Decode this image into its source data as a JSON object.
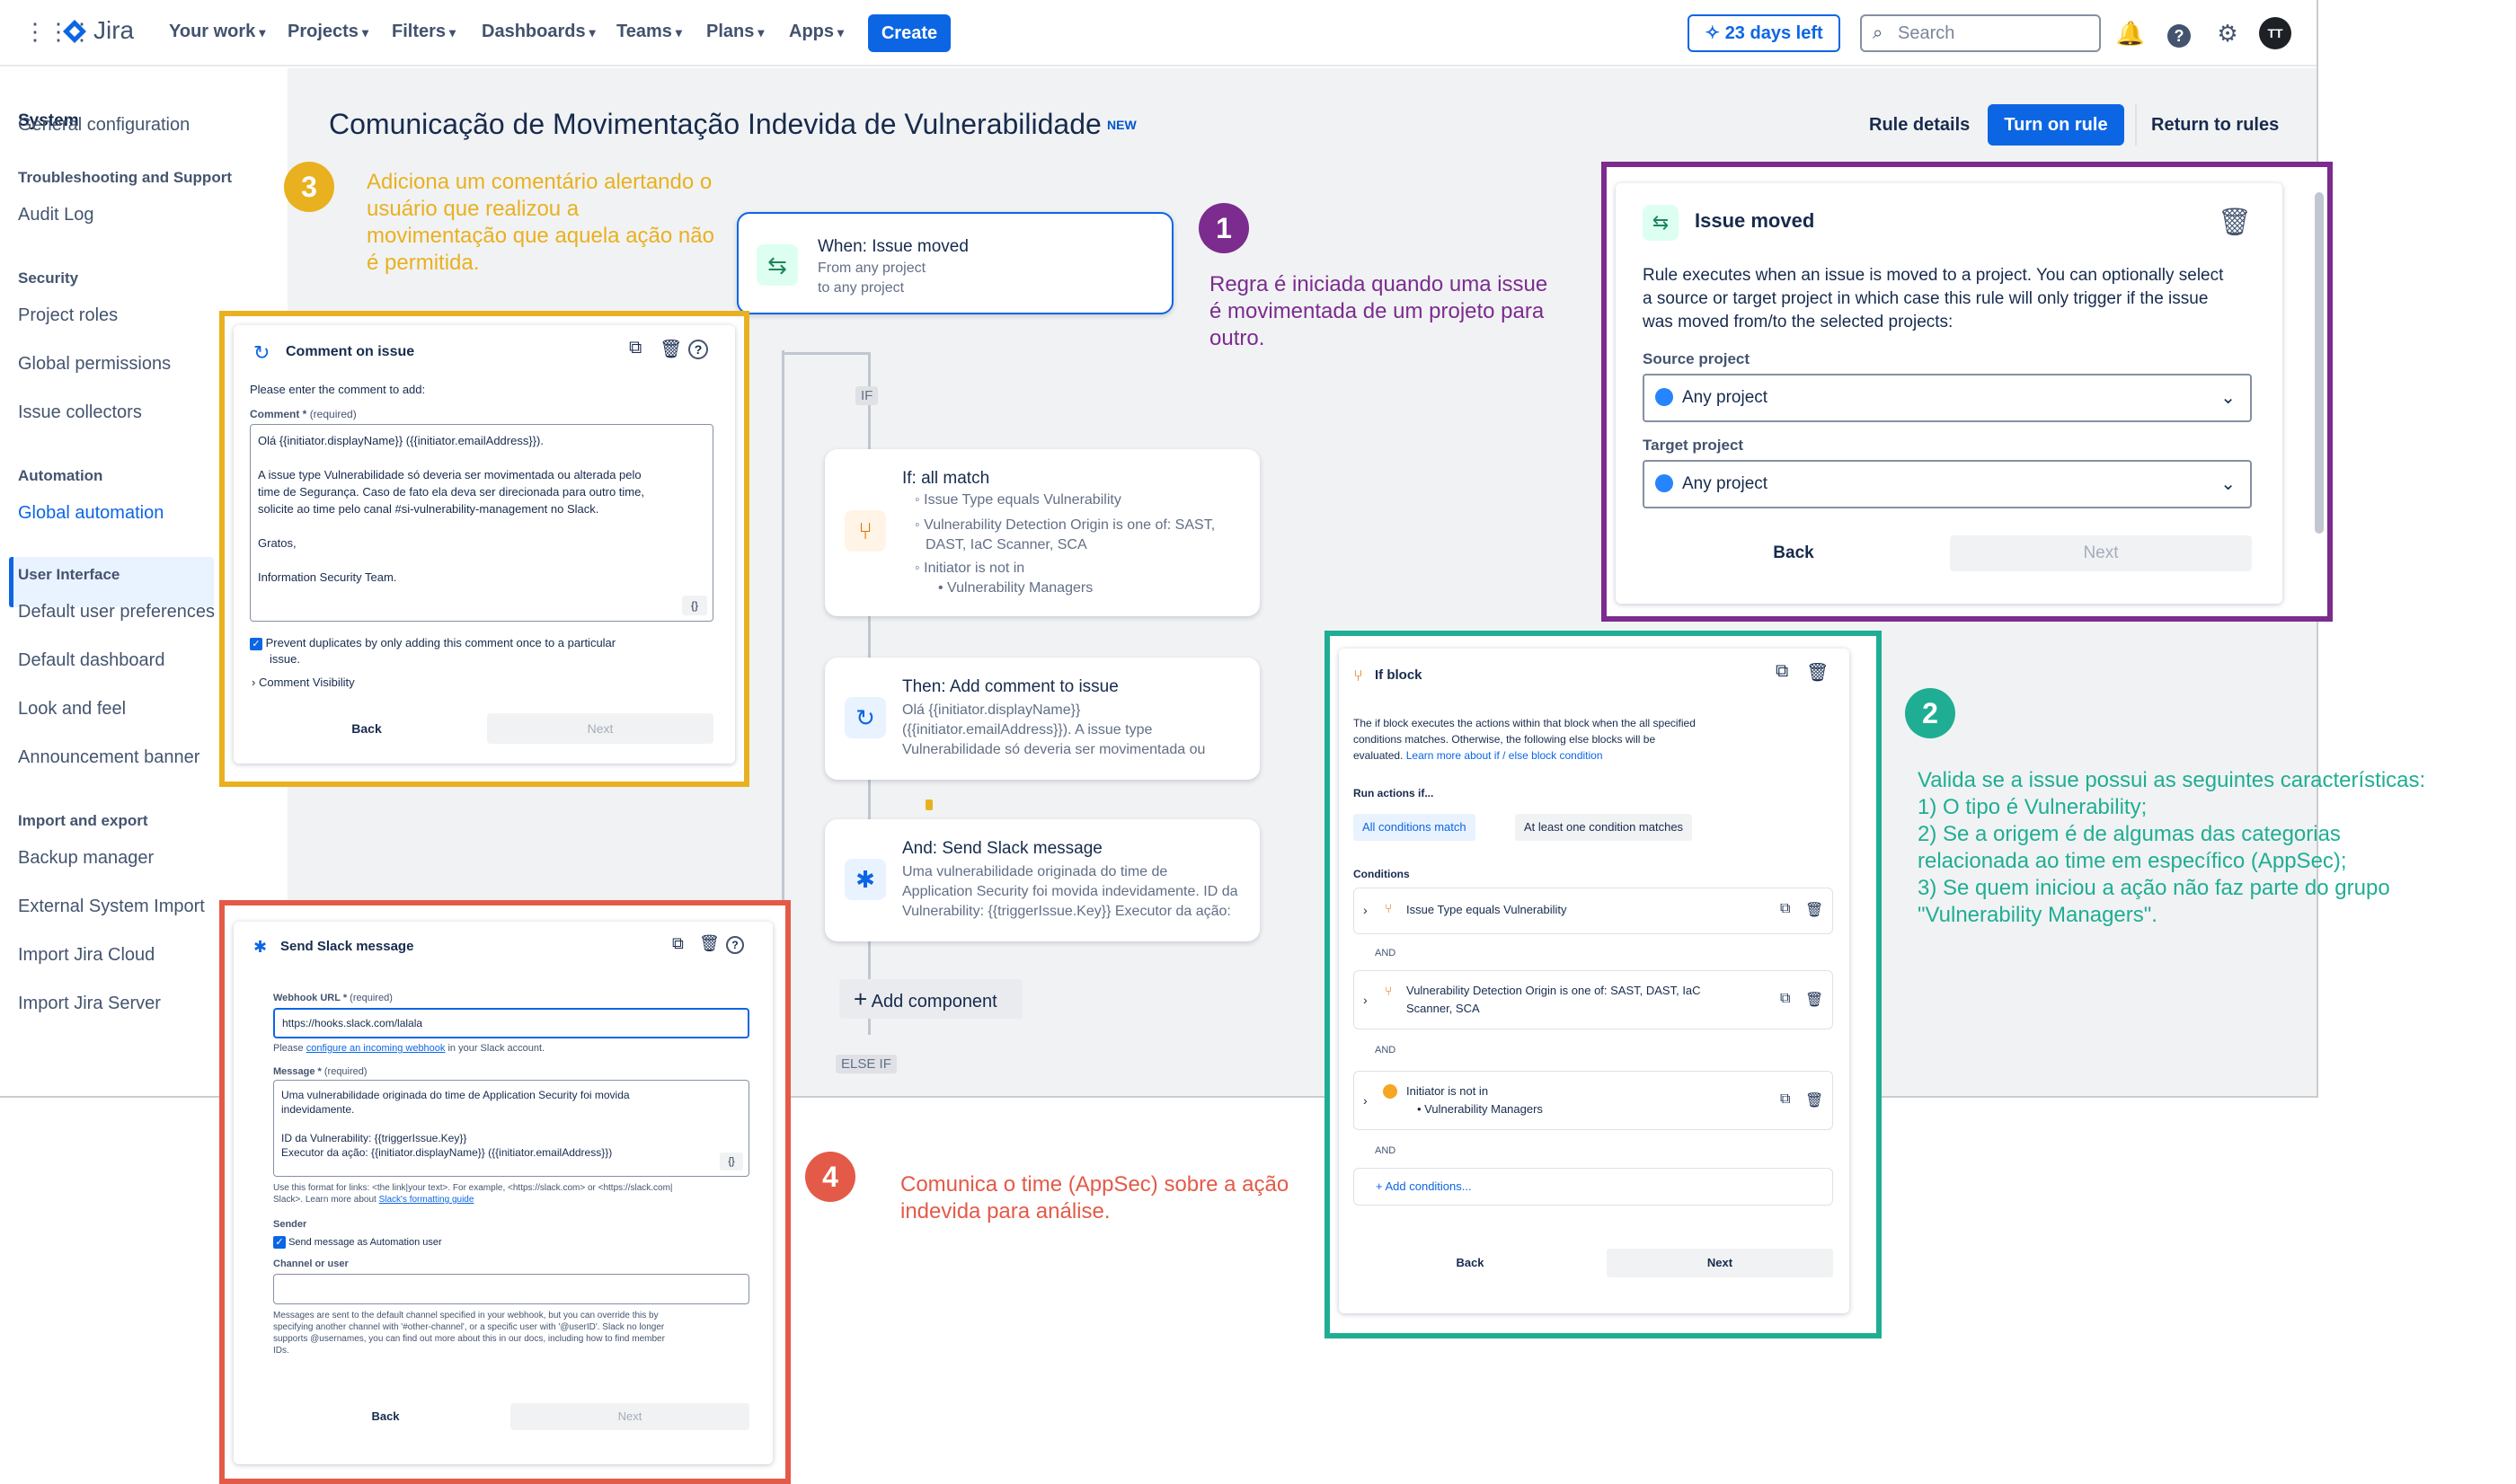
{
  "topnav": {
    "logo": "Jira",
    "items": [
      "Your work",
      "Projects",
      "Filters",
      "Dashboards",
      "Teams",
      "Plans",
      "Apps"
    ],
    "create": "Create",
    "trial": "23 days left",
    "search_placeholder": "Search",
    "avatar": "TT"
  },
  "sidebar": {
    "system": "System",
    "items": [
      {
        "type": "item",
        "label": "General configuration"
      },
      {
        "type": "head",
        "label": "Troubleshooting and Support"
      },
      {
        "type": "item",
        "label": "Audit Log"
      },
      {
        "type": "head",
        "label": "Security"
      },
      {
        "type": "item",
        "label": "Project roles"
      },
      {
        "type": "item",
        "label": "Global permissions"
      },
      {
        "type": "item",
        "label": "Issue collectors"
      },
      {
        "type": "head",
        "label": "Automation"
      },
      {
        "type": "item",
        "label": "Global automation"
      },
      {
        "type": "head",
        "label": "User Interface"
      },
      {
        "type": "item",
        "label": "Default user preferences"
      },
      {
        "type": "item",
        "label": "Default dashboard"
      },
      {
        "type": "item",
        "label": "Look and feel"
      },
      {
        "type": "item",
        "label": "Announcement banner"
      },
      {
        "type": "head",
        "label": "Import and export"
      },
      {
        "type": "item",
        "label": "Backup manager"
      },
      {
        "type": "item",
        "label": "External System Import"
      },
      {
        "type": "item",
        "label": "Import Jira Cloud"
      },
      {
        "type": "item",
        "label": "Import Jira Server"
      }
    ]
  },
  "rule": {
    "title": "Comunicação de Movimentação Indevida de Vulnerabilidade",
    "badge": "NEW",
    "rule_details": "Rule details",
    "turn_on": "Turn on rule",
    "return": "Return to rules"
  },
  "flow": {
    "trigger": {
      "title": "When: Issue moved",
      "sub1": "From any project",
      "sub2": "to any project"
    },
    "if_tag": "IF",
    "ifcard": {
      "title": "If: all match",
      "l1": "Issue Type equals Vulnerability",
      "l2": "Vulnerability Detection Origin is one of: SAST,",
      "l3": "DAST, IaC Scanner, SCA",
      "l4": "Initiator is not in",
      "l5": "Vulnerability Managers"
    },
    "then": {
      "title": "Then: Add comment to issue",
      "l1": "Olá {{initiator.displayName}}",
      "l2": "({{initiator.emailAddress}}). A issue type",
      "l3": "Vulnerabilidade só deveria ser movimentada ou"
    },
    "slack": {
      "title": "And: Send Slack message",
      "l1": "Uma vulnerabilidade originada do time de",
      "l2": "Application Security foi movida indevidamente. ID da",
      "l3": "Vulnerability: {{triggerIssue.Key}} Executor da ação:"
    },
    "add": "Add component",
    "elseif": "ELSE IF"
  },
  "issue_moved": {
    "title": "Issue moved",
    "desc1": "Rule executes when an issue is moved to a project. You can optionally select",
    "desc2": "a source or target project in which case this rule will only trigger if the issue",
    "desc3": "was moved from/to the selected projects:",
    "source_label": "Source project",
    "source_value": "Any project",
    "target_label": "Target project",
    "target_value": "Any project",
    "back": "Back",
    "next": "Next"
  },
  "comment_panel": {
    "title": "Comment on issue",
    "prompt": "Please enter the comment to add:",
    "field_label": "Comment *",
    "required": "(required)",
    "lines": [
      "Olá {{initiator.displayName}} ({{initiator.emailAddress}}).",
      "",
      "A issue type Vulnerabilidade só deveria ser movimentada ou alterada pelo",
      "time de Segurança. Caso de fato ela deva ser direcionada para outro time,",
      "solicite ao time pelo canal #si-vulnerability-management no Slack.",
      "",
      "Gratos,",
      "",
      "Information Security Team."
    ],
    "braces": "{}",
    "checkbox1": "Prevent duplicates by only adding this comment once to a particular",
    "checkbox2": "issue.",
    "visibility": "Comment Visibility",
    "back": "Back",
    "next": "Next"
  },
  "ifblock_panel": {
    "title": "If block",
    "desc1": "The if block executes the actions within that block when the all specified",
    "desc2": "conditions matches. Otherwise, the following else blocks will be",
    "desc3": "evaluated.",
    "learn": "Learn more about if / else block condition",
    "run": "Run actions if...",
    "opt_all": "All conditions match",
    "opt_one": "At least one condition matches",
    "conditions": "Conditions",
    "c1": "Issue Type equals Vulnerability",
    "c2a": "Vulnerability Detection Origin is one of: SAST, DAST, IaC",
    "c2b": "Scanner, SCA",
    "c3a": "Initiator is not in",
    "c3b": "Vulnerability Managers",
    "and": "AND",
    "add": "+ Add conditions...",
    "back": "Back",
    "next": "Next"
  },
  "slack_panel": {
    "title": "Send Slack message",
    "webhook_label": "Webhook URL *",
    "required": "(required)",
    "webhook_value": "https://hooks.slack.com/lalala",
    "please": "Please",
    "configure": "configure an incoming webhook",
    "in_account": "in your Slack account.",
    "message_label": "Message *",
    "msg": [
      "Uma vulnerabilidade originada do time de Application Security foi movida",
      "indevidamente.",
      "",
      "ID da Vulnerability: {{triggerIssue.Key}}",
      "Executor da ação: {{initiator.displayName}} ({{initiator.emailAddress}})"
    ],
    "braces": "{}",
    "fmt1": "Use this format for links: <the link|your text>. For example, <https://slack.com> or <https://slack.com|",
    "fmt2": "Slack>. Learn more about",
    "fmt_link": "Slack's formatting guide",
    "sender": "Sender",
    "sender_chk": "Send message as Automation user",
    "channel": "Channel or user",
    "note": [
      "Messages are sent to the default channel specified in your webhook, but you can override this by",
      "specifying another channel with '#other-channel', or a specific user with '@userID'. Slack no longer",
      "supports @usernames, you can find out more about this in our docs, including how to find member",
      "IDs."
    ],
    "back": "Back",
    "next": "Next"
  },
  "annotations": {
    "n1": "1",
    "t1": [
      "Regra é iniciada quando uma issue",
      "é movimentada de um projeto para",
      "outro."
    ],
    "n2": "2",
    "t2": [
      "Valida se a issue possui as seguintes características:",
      "1) O tipo é Vulnerability;",
      "2) Se a origem é de algumas das categorias",
      "relacionada ao time em específico (AppSec);",
      "3) Se quem iniciou a ação não faz parte do grupo",
      "\"Vulnerability Managers\"."
    ],
    "n3": "3",
    "t3": [
      "Adiciona um comentário alertando o",
      "usuário que realizou a",
      "movimentação que aquela ação não",
      "é permitida."
    ],
    "n4": "4",
    "t4": [
      "Comunica o time (AppSec) sobre a ação",
      "indevida para análise."
    ]
  },
  "colors": {
    "purple": "#7b2c8e",
    "teal": "#1fae93",
    "orange": "#e9b11f",
    "red": "#e45a48",
    "blue": "#0c66e4"
  }
}
